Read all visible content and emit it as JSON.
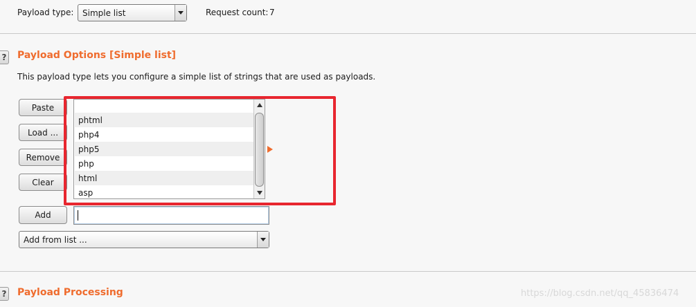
{
  "header": {
    "payload_type_label": "Payload type:",
    "payload_type_value": "Simple list",
    "request_count_label": "Request count:",
    "request_count_value": "7"
  },
  "payload_options": {
    "help_icon_text": "?",
    "title": "Payload Options [Simple list]",
    "description": "This payload type lets you configure a simple list of strings that are used as payloads.",
    "buttons": {
      "paste": "Paste",
      "load": "Load ...",
      "remove": "Remove",
      "clear": "Clear",
      "add": "Add"
    },
    "list_items": [
      "",
      "phtml",
      "php4",
      "php5",
      "php",
      "html",
      "asp"
    ],
    "add_input_value": "",
    "add_from_list_value": "Add from list ..."
  },
  "payload_processing": {
    "help_icon_text": "?",
    "title": "Payload Processing"
  },
  "watermark": "https://blog.csdn.net/qq_45836474",
  "colors": {
    "accent": "#ef6c2e",
    "highlight_box": "#e8262f",
    "background": "#f7f7f7"
  },
  "icons": {
    "dropdown": "chevron-down-icon",
    "help": "help-icon",
    "expand": "triangle-right-icon",
    "scroll_up": "scroll-up-icon",
    "scroll_down": "scroll-down-icon"
  }
}
